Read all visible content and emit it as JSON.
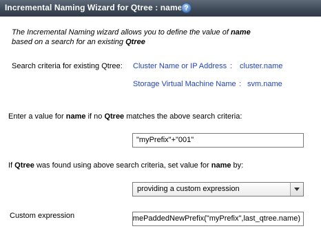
{
  "window": {
    "title": "Incremental Naming Wizard for Qtree : name",
    "help_icon": "question-mark-icon"
  },
  "intro": {
    "line1_prefix": "The Incremental Naming wizard allows you to define the value of ",
    "line1_bold": "name",
    "line2_prefix": "based on a search for an existing ",
    "line2_bold": "Qtree"
  },
  "search_criteria": {
    "label": "Search criteria for existing Qtree:",
    "rows": [
      {
        "name": "Cluster Name or IP Address",
        "sep": ":",
        "value": "cluster.name"
      },
      {
        "name": "Storage Virtual Machine Name",
        "sep": ":",
        "value": "svm.name"
      }
    ]
  },
  "no_match": {
    "t1": "Enter a value for ",
    "b1": "name",
    "t2": " if no ",
    "b2": "Qtree",
    "t3": " matches the above search criteria:",
    "value": "\"myPrefix\"+\"001\""
  },
  "found": {
    "t1": "If ",
    "b1": "Qtree",
    "t2": " was found using above search criteria, set value for ",
    "b2": "name",
    "t3": " by:",
    "selected_option": "providing a custom expression"
  },
  "custom_expression": {
    "label": "Custom expression",
    "value": "nextNamePaddedNewPrefix(\"myPrefix\",last_qtree.name)"
  }
}
